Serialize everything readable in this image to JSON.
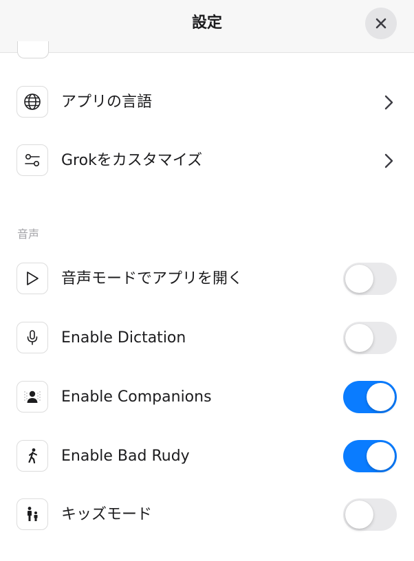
{
  "header": {
    "title": "設定"
  },
  "rows_top": [
    {
      "label": "アプリの言語",
      "icon": "globe-icon"
    },
    {
      "label": "Grokをカスタマイズ",
      "icon": "sliders-icon"
    }
  ],
  "voice_section": {
    "header": "音声",
    "rows": [
      {
        "label": "音声モードでアプリを開く",
        "icon": "play-icon",
        "enabled": false
      },
      {
        "label": "Enable Dictation",
        "icon": "microphone-icon",
        "enabled": false
      },
      {
        "label": "Enable Companions",
        "icon": "person-icon",
        "enabled": true
      },
      {
        "label": "Enable Bad Rudy",
        "icon": "running-figure-icon",
        "enabled": true
      },
      {
        "label": "キッズモード",
        "icon": "parent-child-icon",
        "enabled": false
      }
    ]
  },
  "colors": {
    "toggle_on": "#0a7cff",
    "toggle_off": "#e9e9eb"
  }
}
